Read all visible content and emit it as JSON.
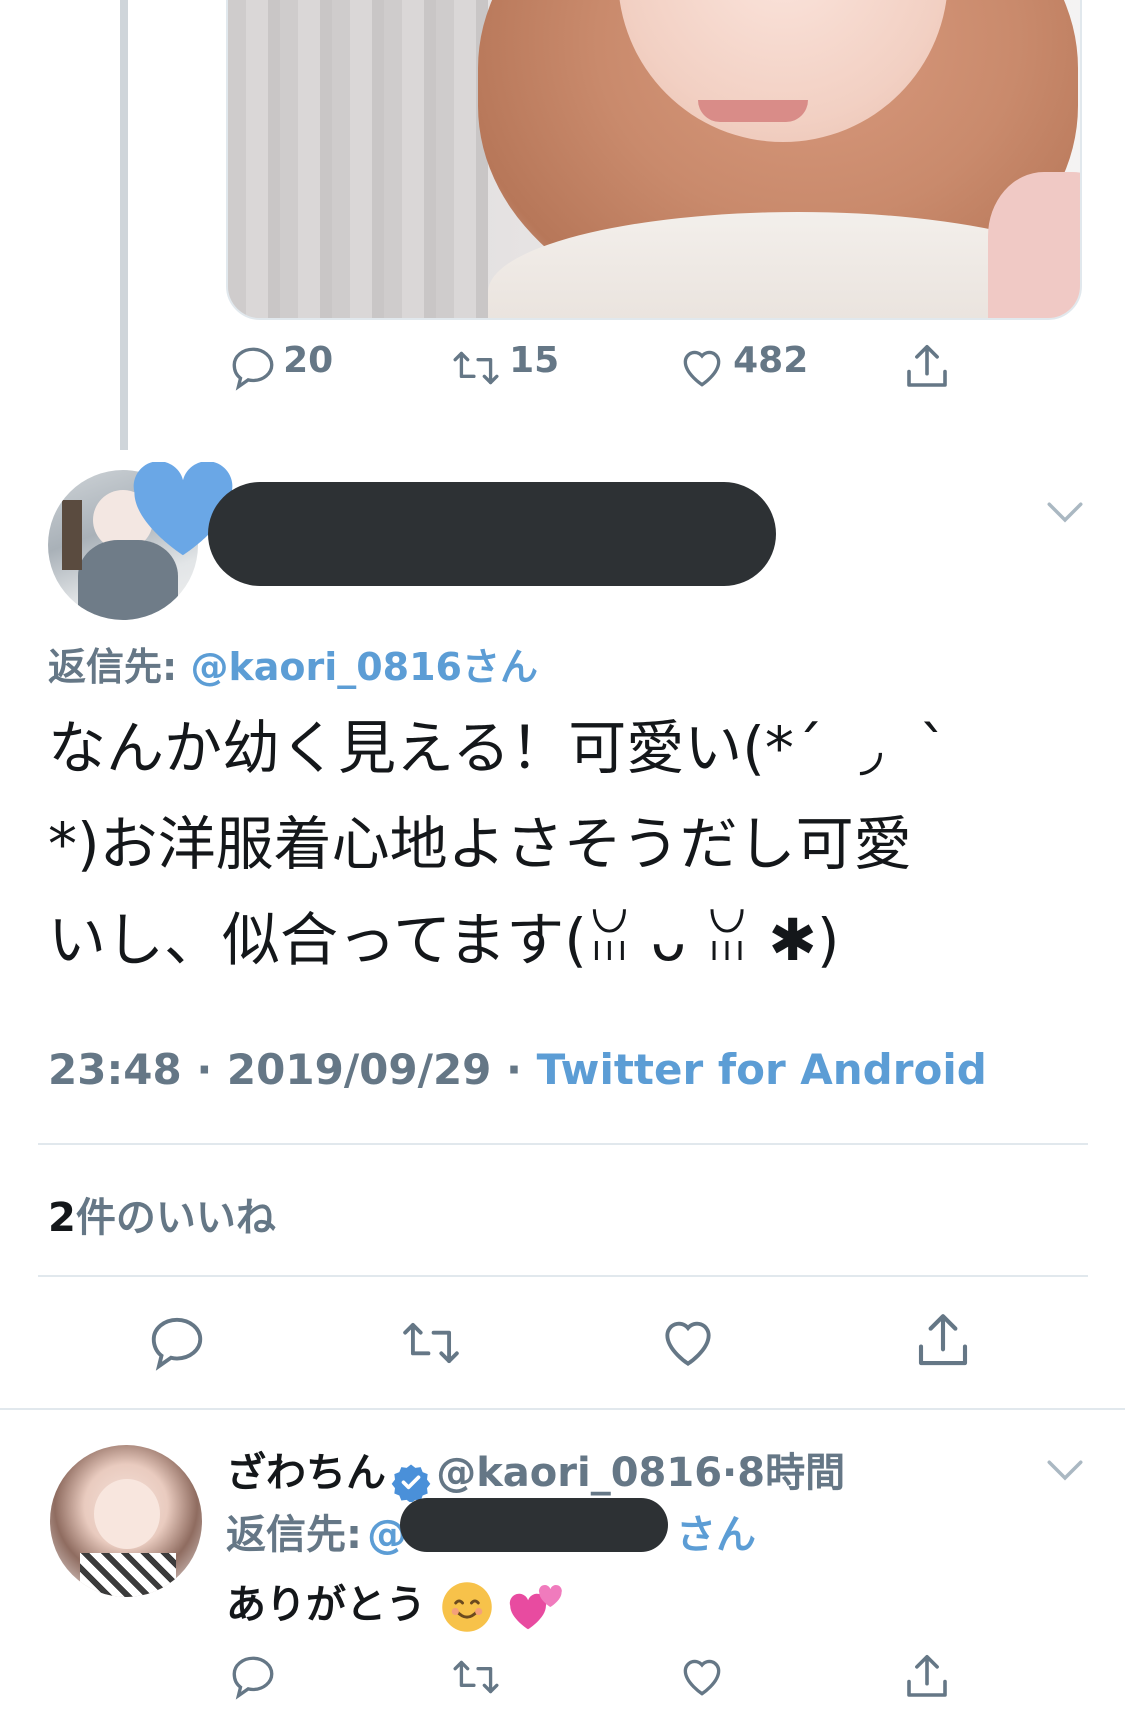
{
  "quoted_tweet": {
    "stats": {
      "replies": "20",
      "retweets": "15",
      "likes": "482"
    }
  },
  "reply": {
    "reply_to_label": "返信先:",
    "reply_to_handle": "@kaori_0816さん",
    "text_line1": "なんか幼く見える！可愛い(*´ ︎ ◞ ︎ `",
    "text_line2": "*)お洋服着心地よさそうだし可愛",
    "text_line3": "いし、似合ってます(ꈍ ᴗ ꈍ ✱)",
    "time": "23:48",
    "date": "2019/09/29",
    "separator": "·",
    "source": "Twitter for Android",
    "likes_count": "2",
    "likes_label": "件のいいね"
  },
  "reply2": {
    "name": "ざわちん",
    "handle": "@kaori_0816",
    "separator": "·",
    "time": "8時間",
    "reply_to_label": "返信先:",
    "reply_to_prefix": "@",
    "reply_to_suffix": "さん",
    "text": "ありがとう"
  },
  "colors": {
    "link": "#5c9dd5",
    "muted": "#657786",
    "verified": "#4a90d9",
    "heart_badge": "#6aa7e6"
  },
  "icons": [
    "comment-icon",
    "retweet-icon",
    "heart-icon",
    "share-icon",
    "chevron-down-icon",
    "verified-badge-icon",
    "smile-emoji",
    "two-hearts-emoji"
  ]
}
